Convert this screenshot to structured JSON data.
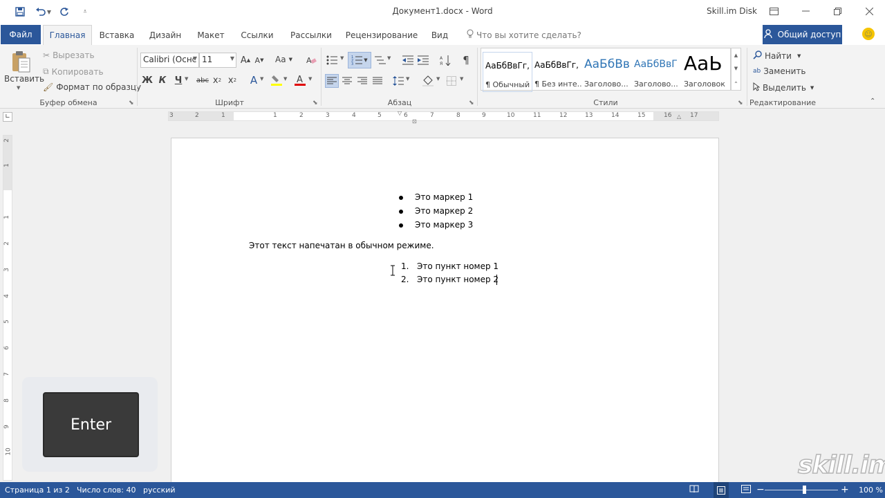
{
  "window": {
    "title": "Документ1.docx - Word",
    "account": "Skill.im Disk"
  },
  "qat": {
    "icons": [
      "save-icon",
      "undo-icon",
      "redo-icon",
      "customize-qat-icon"
    ]
  },
  "tabs": {
    "file": "Файл",
    "items": [
      "Главная",
      "Вставка",
      "Дизайн",
      "Макет",
      "Ссылки",
      "Рассылки",
      "Рецензирование",
      "Вид"
    ],
    "active": "Главная",
    "tellme": "Что вы хотите сделать?",
    "share": "Общий доступ"
  },
  "ribbon": {
    "clipboard": {
      "paste": "Вставить",
      "cut": "Вырезать",
      "copy": "Копировать",
      "format_painter": "Формат по образцу",
      "label": "Буфер обмена"
    },
    "font": {
      "font_name": "Calibri (Оснс",
      "font_size": "11",
      "case_btn": "Aa",
      "bold": "Ж",
      "italic": "К",
      "underline": "Ч",
      "strike": "abc",
      "label": "Шрифт"
    },
    "paragraph": {
      "label": "Абзац"
    },
    "styles": {
      "items": [
        {
          "sample": "АаБбВвГг,",
          "name": "¶ Обычный"
        },
        {
          "sample": "АаБбВвГг,",
          "name": "¶ Без инте..."
        },
        {
          "sample": "АаБбВв",
          "name": "Заголово..."
        },
        {
          "sample": "АаБбВвГ",
          "name": "Заголово..."
        },
        {
          "sample": "АаЬ",
          "name": "Заголовок"
        }
      ],
      "label": "Стили"
    },
    "editing": {
      "find": "Найти",
      "replace": "Заменить",
      "select": "Выделить",
      "label": "Редактирование"
    }
  },
  "ruler": {
    "h_numbers": [
      "3",
      "2",
      "1",
      "1",
      "2",
      "3",
      "4",
      "5",
      "6",
      "7",
      "8",
      "9",
      "10",
      "11",
      "12",
      "13",
      "14",
      "15",
      "16",
      "17"
    ],
    "v_numbers": [
      "2",
      "1",
      "1",
      "2",
      "3",
      "4",
      "5",
      "6",
      "7",
      "8",
      "9",
      "10"
    ]
  },
  "document": {
    "bullets": [
      "Это маркер 1",
      "Это маркер 2",
      "Это маркер 3"
    ],
    "paragraph": "Этот текст напечатан в обычном режиме.",
    "numbered": [
      {
        "num": "1.",
        "text": "Это пункт номер 1"
      },
      {
        "num": "2.",
        "text": "Это пункт номер 2"
      }
    ]
  },
  "overlay": {
    "key": "Enter",
    "watermark": "skill.im"
  },
  "status": {
    "page": "Страница 1 из 2",
    "words": "Число слов: 40",
    "language": "русский",
    "zoom": "100 %"
  },
  "colors": {
    "accent": "#2b579a",
    "heading_style": "#2e74b5"
  }
}
